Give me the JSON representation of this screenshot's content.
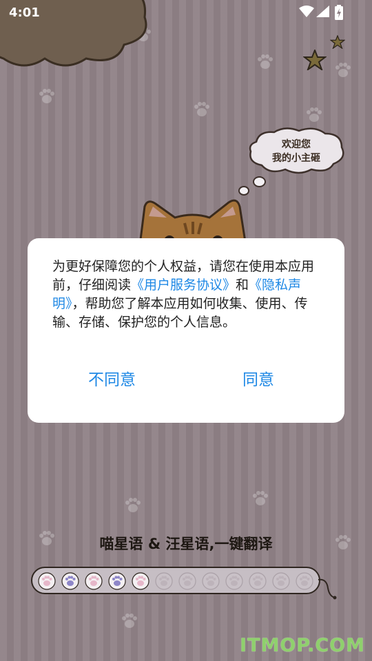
{
  "status_bar": {
    "time": "4:01",
    "icons": [
      "wifi-icon",
      "signal-icon",
      "battery-charging-icon"
    ]
  },
  "bubble": {
    "line1": "欢迎您",
    "line2": "我的小主砸"
  },
  "dialog": {
    "text_before_link1": "为更好保障您的个人权益，请您在使用本应用前，仔细阅读",
    "link_user_agreement": "《用户服务协议》",
    "text_between_links": "和",
    "link_privacy": "《隐私声明》",
    "text_after_links": "，帮助您了解本应用如何收集、使用、传输、存储、保护您的个人信息。",
    "disagree_label": "不同意",
    "agree_label": "同意"
  },
  "slogan": "喵星语 & 汪星语,一键翻译",
  "loading": {
    "total_paws": 12,
    "filled_paws": 5
  },
  "watermark": "ITMOP.COM",
  "colors": {
    "accent": "#1e88e5",
    "background": "#8f8186",
    "dialog_bg": "#ffffff"
  }
}
